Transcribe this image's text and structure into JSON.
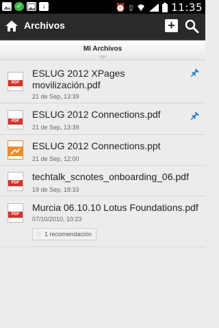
{
  "status_bar": {
    "time": "11:35"
  },
  "app_bar": {
    "title": "Archivos"
  },
  "section": {
    "title": "Mi Archivos"
  },
  "files": [
    {
      "name": "ESLUG 2012 XPages movilización.pdf",
      "date": "21 de Sep, 13:39",
      "type": "PDF",
      "pinned": true
    },
    {
      "name": "ESLUG 2012 Connections.pdf",
      "date": "21 de Sep, 13:39",
      "type": "PDF",
      "pinned": true
    },
    {
      "name": "ESLUG 2012 Connections.ppt",
      "date": "21 de Sep, 12:00",
      "type": "PPT",
      "pinned": false
    },
    {
      "name": "techtalk_scnotes_onboarding_06.pdf",
      "date": "19 de Sep, 18:33",
      "type": "PDF",
      "pinned": false
    },
    {
      "name": "Murcia 06.10.10 Lotus Foundations.pdf",
      "date": "07/10/2010, 10:23",
      "type": "PDF",
      "pinned": false,
      "recommendations": "1 recomendación"
    }
  ],
  "icons": [
    "gallery-icon",
    "check-icon",
    "image-icon",
    "download-icon",
    "alarm-icon",
    "vibrate-icon",
    "wifi-icon",
    "signal-icon",
    "battery-icon",
    "home-icon",
    "add-icon",
    "search-icon",
    "pdf-icon",
    "ppt-icon",
    "pin-icon",
    "star-icon"
  ]
}
